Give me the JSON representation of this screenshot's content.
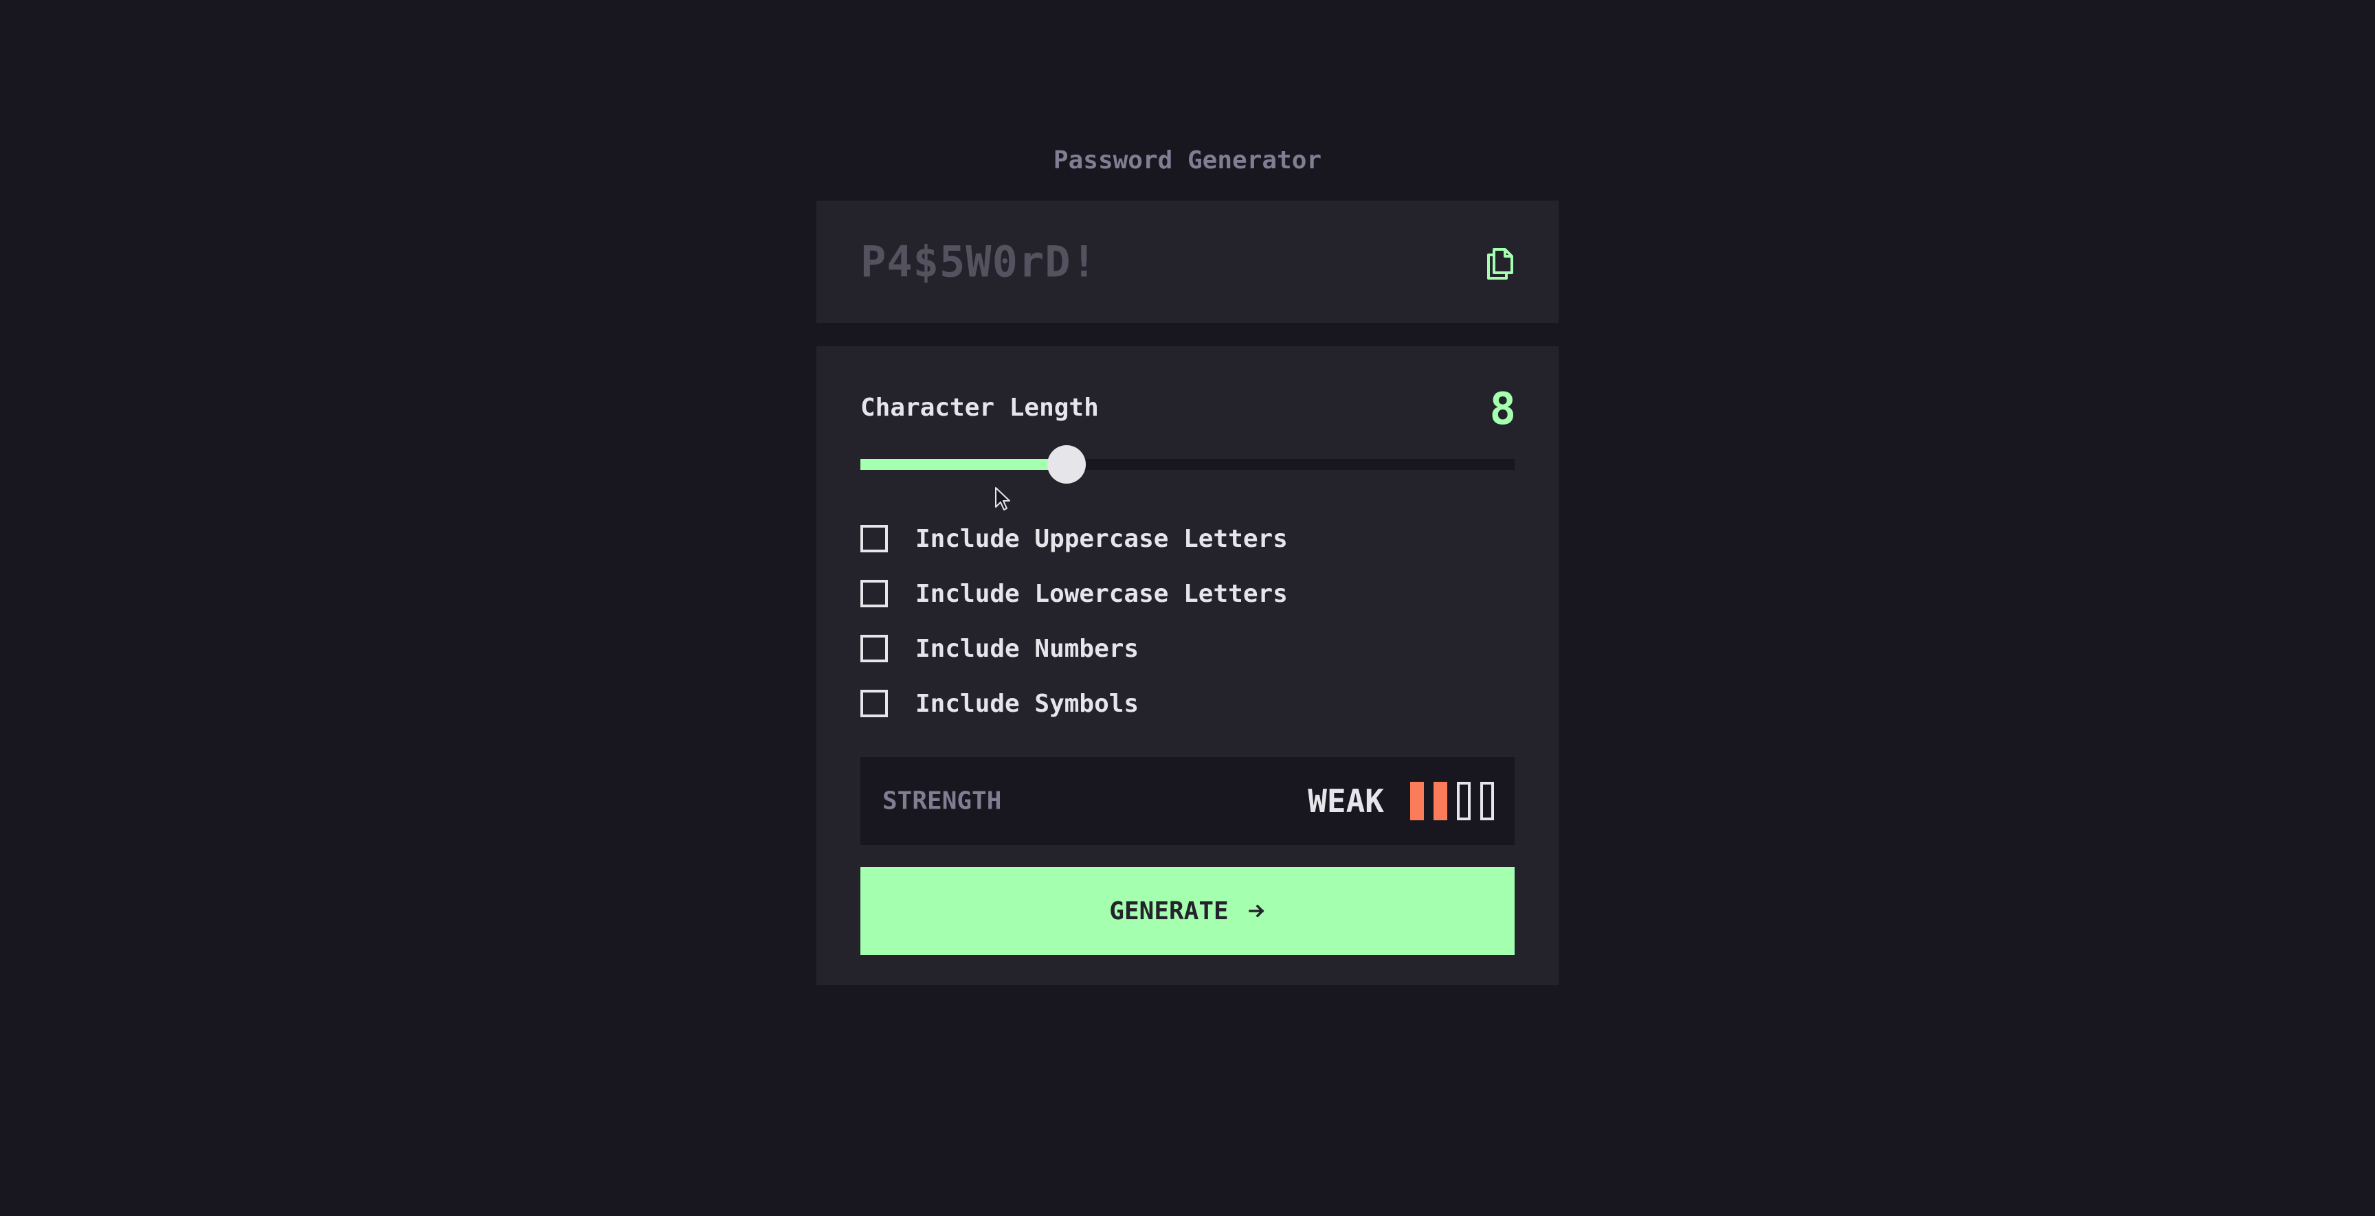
{
  "app": {
    "title": "Password Generator"
  },
  "output": {
    "password": "P4$5W0rD!",
    "copy_icon": "copy-icon"
  },
  "config": {
    "length_label": "Character Length",
    "length_value": "8",
    "slider_fraction": 0.315,
    "options": [
      {
        "label": "Include Uppercase Letters",
        "checked": false
      },
      {
        "label": "Include Lowercase Letters",
        "checked": false
      },
      {
        "label": "Include Numbers",
        "checked": false
      },
      {
        "label": "Include Symbols",
        "checked": false
      }
    ]
  },
  "strength": {
    "label": "STRENGTH",
    "rating": "WEAK",
    "level": 2,
    "max_level": 4
  },
  "generate": {
    "label": "GENERATE",
    "icon": "arrow-right-icon"
  },
  "colors": {
    "background": "#18171f",
    "panel": "#24232c",
    "accent": "#a4ffaf",
    "weak": "#f64a4a",
    "weak_orange": "#fb7c58",
    "text": "#e6e5ea",
    "muted": "#817d92"
  }
}
